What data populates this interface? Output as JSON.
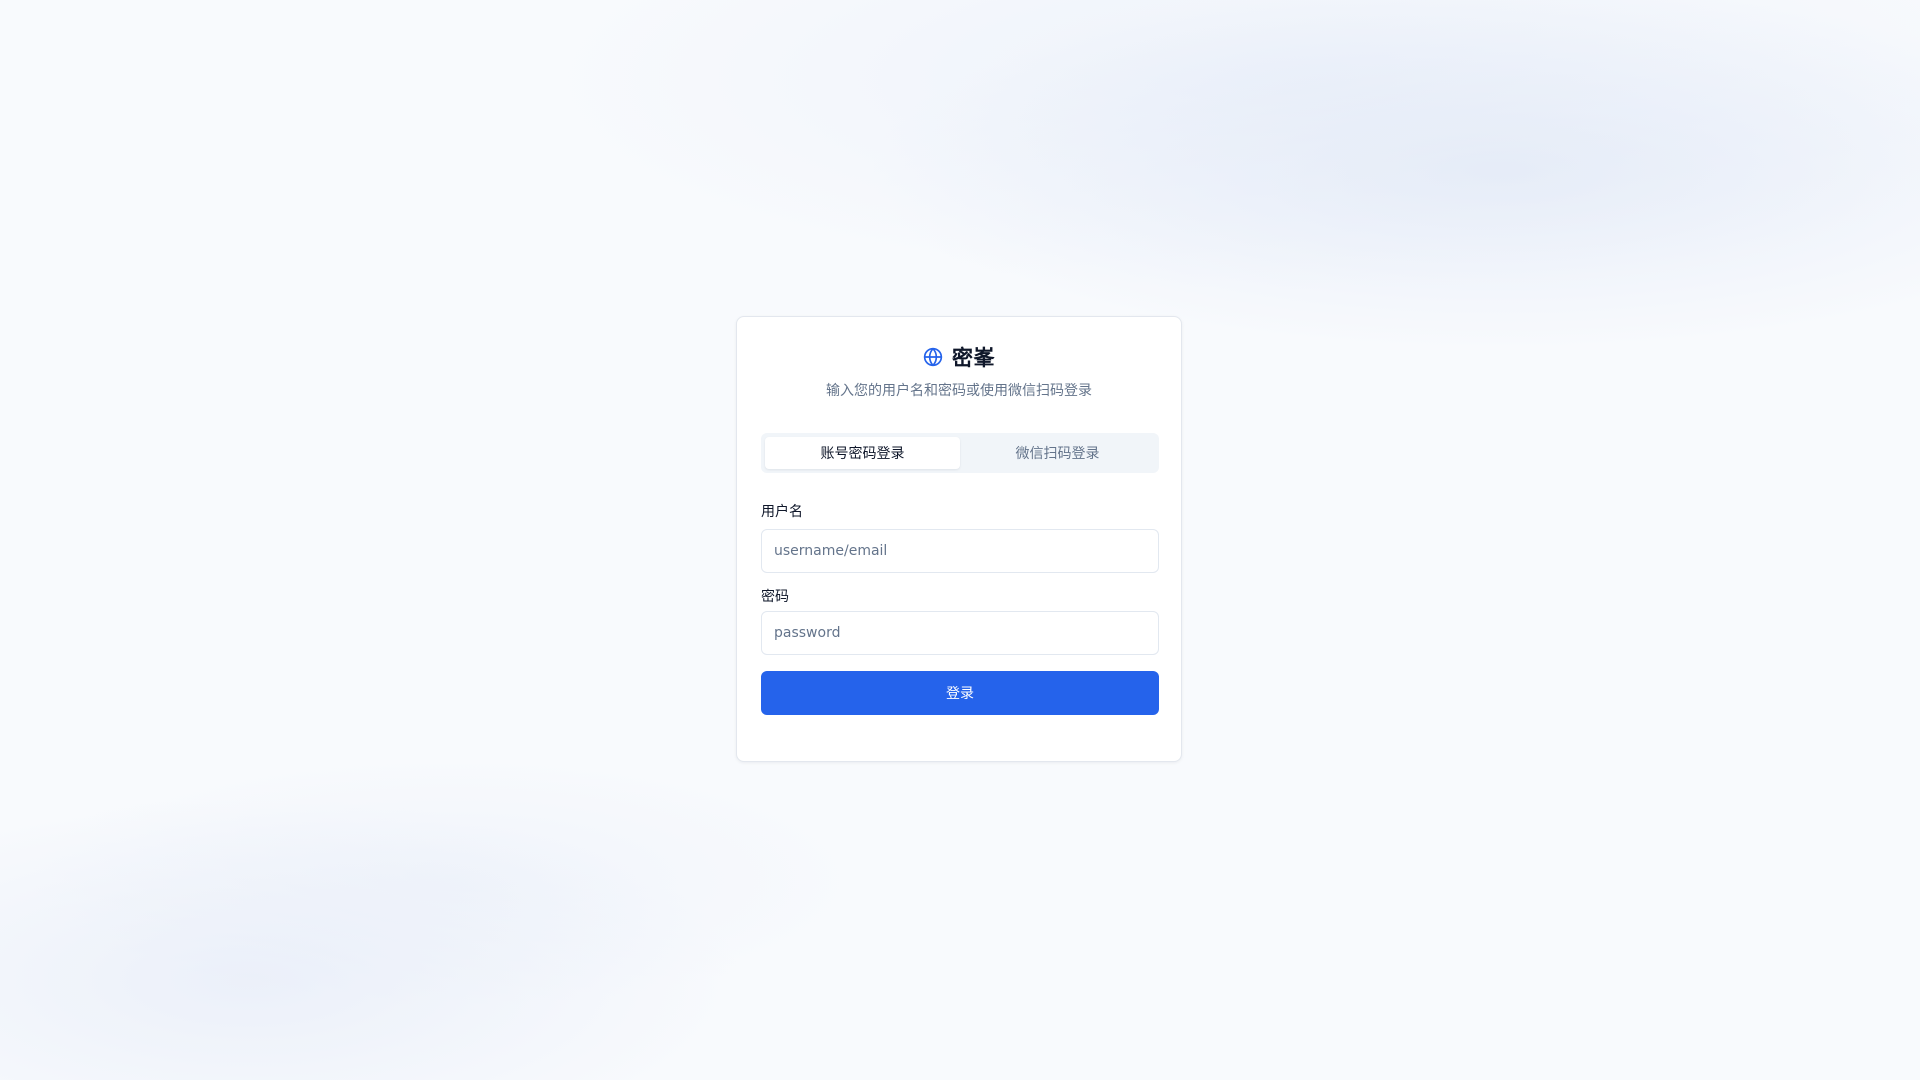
{
  "brand": {
    "title": "密峯",
    "icon": "globe-icon",
    "subtitle": "输入您的用户名和密码或使用微信扫码登录"
  },
  "tabs": [
    {
      "label": "账号密码登录",
      "active": true
    },
    {
      "label": "微信扫码登录",
      "active": false
    }
  ],
  "form": {
    "username": {
      "label": "用户名",
      "placeholder": "username/email",
      "value": ""
    },
    "password": {
      "label": "密码",
      "placeholder": "password",
      "value": ""
    },
    "submit_label": "登录"
  },
  "colors": {
    "accent": "#2563eb",
    "muted_text": "#64748b",
    "tab_background": "#f1f5f9"
  }
}
